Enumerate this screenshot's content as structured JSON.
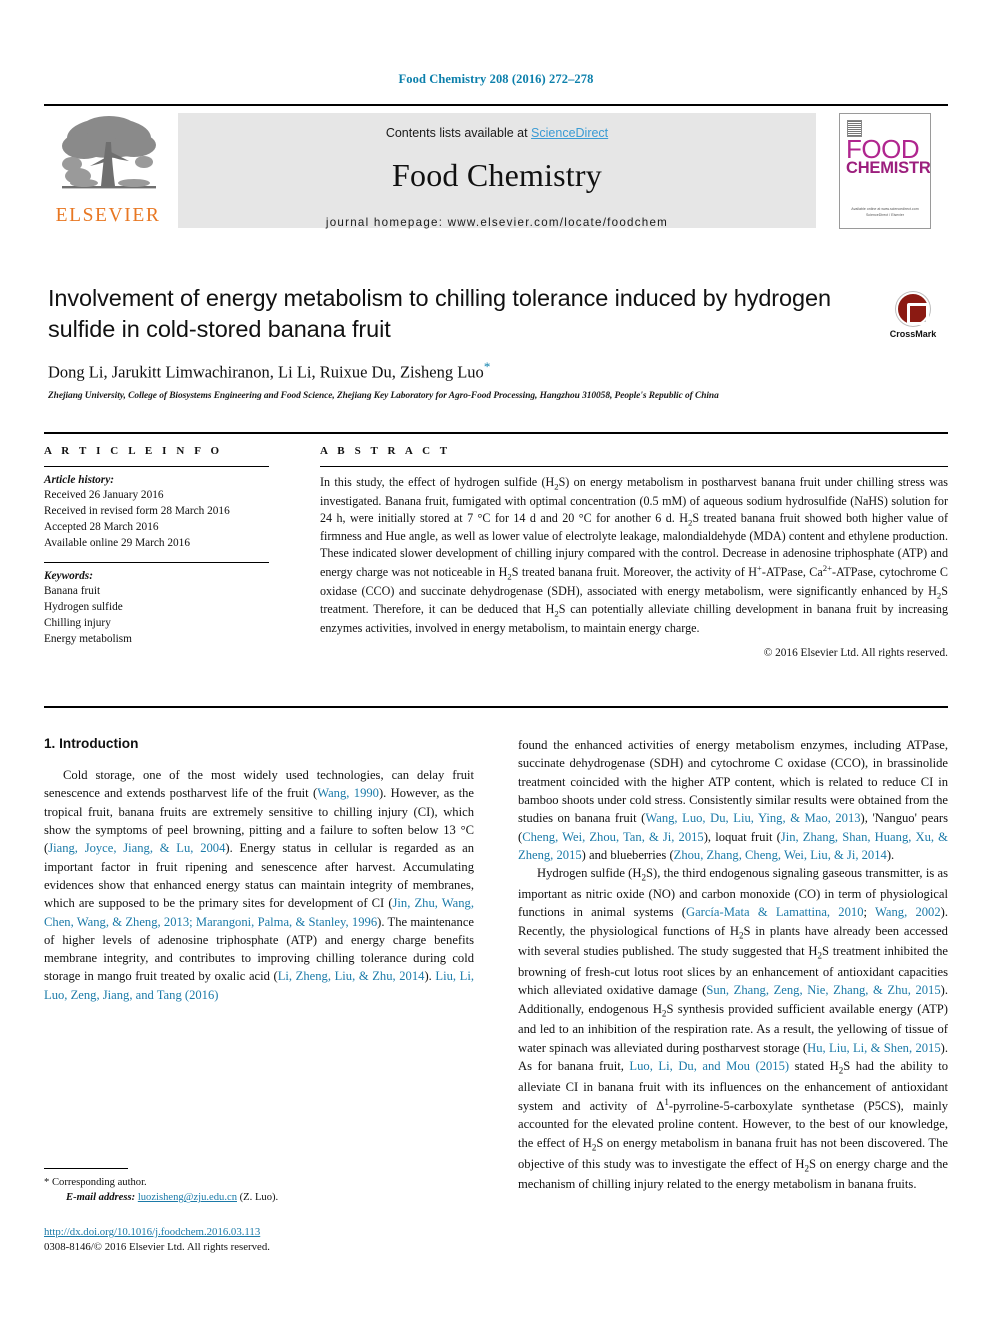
{
  "running_head": "Food Chemistry 208 (2016) 272–278",
  "masthead": {
    "contents_prefix": "Contents lists available at ",
    "contents_link": "ScienceDirect",
    "journal_title": "Food Chemistry",
    "homepage": "journal homepage: www.elsevier.com/locate/foodchem",
    "publisher_word": "ELSEVIER",
    "publisher_icon": "elsevier-tree-logo",
    "cover": {
      "line1": "FOOD",
      "line2": "CHEMISTRY",
      "footer": "Available online at www.sciencedirect.com\nScienceDirect / Elsevier"
    }
  },
  "crossmark": {
    "label": "CrossMark",
    "icon": "crossmark-badge-icon"
  },
  "article": {
    "title": "Involvement of energy metabolism to chilling tolerance induced by hydrogen sulfide in cold-stored banana fruit",
    "authors": "Dong Li, Jarukitt Limwachiranon, Li Li, Ruixue Du, Zisheng Luo",
    "corresponding_marker": "*",
    "affiliation": "Zhejiang University, College of Biosystems Engineering and Food Science, Zhejiang Key Laboratory for Agro-Food Processing, Hangzhou 310058, People's Republic of China"
  },
  "article_info": {
    "heading": "A R T I C L E   I N F O",
    "history_label": "Article history:",
    "history": [
      "Received 26 January 2016",
      "Received in revised form 28 March 2016",
      "Accepted 28 March 2016",
      "Available online 29 March 2016"
    ],
    "keywords_label": "Keywords:",
    "keywords": [
      "Banana fruit",
      "Hydrogen sulfide",
      "Chilling injury",
      "Energy metabolism"
    ]
  },
  "abstract": {
    "heading": "A B S T R A C T",
    "text": "In this study, the effect of hydrogen sulfide (H2S) on energy metabolism in postharvest banana fruit under chilling stress was investigated. Banana fruit, fumigated with optimal concentration (0.5 mM) of aqueous sodium hydrosulfide (NaHS) solution for 24 h, were initially stored at 7 °C for 14 d and 20 °C for another 6 d. H2S treated banana fruit showed both higher value of firmness and Hue angle, as well as lower value of electrolyte leakage, malondialdehyde (MDA) content and ethylene production. These indicated slower development of chilling injury compared with the control. Decrease in adenosine triphosphate (ATP) and energy charge was not noticeable in H2S treated banana fruit. Moreover, the activity of H+-ATPase, Ca2+-ATPase, cytochrome C oxidase (CCO) and succinate dehydrogenase (SDH), associated with energy metabolism, were significantly enhanced by H2S treatment. Therefore, it can be deduced that H2S can potentially alleviate chilling development in banana fruit by increasing enzymes activities, involved in energy metabolism, to maintain energy charge.",
    "copyright": "© 2016 Elsevier Ltd. All rights reserved."
  },
  "introduction": {
    "heading": "1. Introduction",
    "paragraph1_parts": [
      "Cold storage, one of the most widely used technologies, can delay fruit senescence and extends postharvest life of the fruit (",
      "Wang, 1990",
      "). However, as the tropical fruit, banana fruits are extremely sensitive to chilling injury (CI), which show the symptoms of peel browning, pitting and a failure to soften below 13 °C (",
      "Jiang, Joyce, Jiang, & Lu, 2004",
      "). Energy status in cellular is regarded as an important factor in fruit ripening and senescence after harvest. Accumulating evidences show that enhanced energy status can maintain integrity of membranes, which are supposed to be the primary sites for development of CI (",
      "Jin, Zhu, Wang, Chen, Wang, & Zheng, 2013; Marangoni, Palma, & Stanley, 1996",
      "). The maintenance of higher levels of adenosine triphosphate (ATP) and energy charge benefits membrane integrity, and contributes to improving chilling tolerance during cold storage in mango fruit treated by oxalic acid (",
      "Li, Zheng, Liu, & Zhu, 2014",
      "). ",
      "Liu, Li, Luo, Zeng, Jiang, and Tang (2016)",
      " found the enhanced activities of energy metabolism enzymes, including ATPase, succinate dehydrogenase (SDH) and cytochrome C oxidase (CCO), in brassinolide treatment coincided with the higher ATP content, which is related to reduce CI in bamboo shoots under cold stress. Consistently similar results were obtained from the studies on banana fruit (",
      "Wang, Luo, Du, Liu, Ying, & Mao, 2013",
      "), 'Nanguo' pears (",
      "Cheng, Wei, Zhou, Tan, & Ji, 2015",
      "), loquat fruit (",
      "Jin, Zhang, Shan, Huang, Xu, & Zheng, 2015",
      ") and blueberries (",
      "Zhou, Zhang, Cheng, Wei, Liu, & Ji, 2014",
      ")."
    ],
    "paragraph2_parts": [
      "Hydrogen sulfide (H2S), the third endogenous signaling gaseous transmitter, is as important as nitric oxide (NO) and carbon monoxide (CO) in term of physiological functions in animal systems (",
      "García-Mata & Lamattina, 2010",
      "; ",
      "Wang, 2002",
      "). Recently, the physiological functions of H2S in plants have already been accessed with several studies published. The study suggested that H2S treatment inhibited the browning of fresh-cut lotus root slices by an enhancement of antioxidant capacities which alleviated oxidative damage (",
      "Sun, Zhang, Zeng, Nie, Zhang, & Zhu, 2015",
      "). Additionally, endogenous H2S synthesis provided sufficient available energy (ATP) and led to an inhibition of the respiration rate. As a result, the yellowing of tissue of water spinach was alleviated during postharvest storage (",
      "Hu, Liu, Li, & Shen, 2015",
      "). As for banana fruit, ",
      "Luo, Li, Du, and Mou (2015)",
      " stated H2S had the ability to alleviate CI in banana fruit with its influences on the enhancement of antioxidant system and activity of Δ1-pyrroline-5-carboxylate synthetase (P5CS), mainly accounted for the elevated proline content. However, to the best of our knowledge, the effect of H2S on energy metabolism in banana fruit has not been discovered. The objective of this study was to investigate the effect of H2S on energy charge and the mechanism of chilling injury related to the energy metabolism in banana fruits."
    ]
  },
  "footnote": {
    "corresponding_marker": "*",
    "corresponding_text": "Corresponding author.",
    "email_label": "E-mail address:",
    "email": "luozisheng@zju.edu.cn",
    "email_suffix": "(Z. Luo).",
    "doi": "http://dx.doi.org/10.1016/j.foodchem.2016.03.113",
    "issn_line_prefix": "0308-8146/",
    "issn_line_rest": "© 2016 Elsevier Ltd. All rights reserved."
  },
  "colors": {
    "link_blue": "#1b7aa8",
    "header_blue": "#0b7fab",
    "sciencedirect_blue": "#3a9bd4",
    "elsevier_orange": "#e87722",
    "cover_magenta": "#b0268f",
    "crossmark_red": "#8b1a12"
  }
}
